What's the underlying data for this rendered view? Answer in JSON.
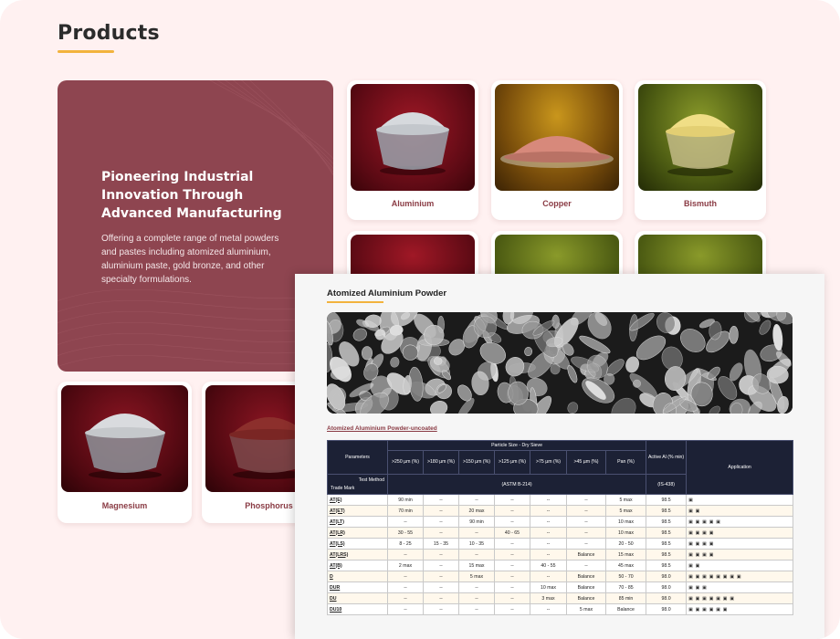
{
  "page": {
    "heading": "Products"
  },
  "hero": {
    "title": "Pioneering Industrial Innovation Through Advanced Manufacturing",
    "description": "Offering a complete range of metal powders and pastes including atomized aluminium, aluminium paste, gold bronze, and other specialty formulations."
  },
  "products": [
    {
      "name": "Aluminium",
      "color": "#bfc3c8",
      "bg": "#6e0f1a"
    },
    {
      "name": "Copper",
      "color": "#d88a78",
      "bg": "#8a5a10"
    },
    {
      "name": "Bismuth",
      "color": "#e9d57a",
      "bg": "#4b5a12"
    },
    {
      "name": "Magnesium",
      "color": "#bdbdbd",
      "bg": "#5a0c14"
    },
    {
      "name": "Phosphorus",
      "color": "#8c2f2c",
      "bg": "#5a0c14"
    }
  ],
  "panel": {
    "title": "Atomized Aluminium Powder",
    "subtitle": "Atomized Aluminium Powder-uncoated",
    "table": {
      "head_parameters": "Parameters",
      "head_particle": "Particle Size - Dry Sieve",
      "head_active": "Active Al (% min)",
      "head_application": "Application",
      "sizes": [
        ">250 µm (%)",
        ">180 µm (%)",
        ">150 µm (%)",
        ">125 µm (%)",
        ">75 µm (%)",
        ">45 µm (%)",
        "Pan (%)"
      ],
      "test_method": "Test Method",
      "trade_mark": "Trade Mark",
      "method_sieve": "(ASTM B-214)",
      "method_active": "(IS-438)",
      "rows": [
        {
          "tm": "AT(E)",
          "v": [
            "90 min",
            "--",
            "--",
            "--",
            "--",
            "--",
            "5 max"
          ],
          "al": "98.5",
          "app": "▣"
        },
        {
          "tm": "AT(ET)",
          "v": [
            "70 min",
            "--",
            "20 max",
            "--",
            "--",
            "--",
            "5 max"
          ],
          "al": "98.5",
          "app": "▣ ▣"
        },
        {
          "tm": "AT(LT)",
          "v": [
            "--",
            "--",
            "90 min",
            "--",
            "--",
            "--",
            "10 max"
          ],
          "al": "98.5",
          "app": "▣ ▣ ▣ ▣ ▣"
        },
        {
          "tm": "AT(LR)",
          "v": [
            "30 - 55",
            "--",
            "--",
            "40 - 65",
            "--",
            "--",
            "10 max"
          ],
          "al": "98.5",
          "app": "▣ ▣ ▣ ▣"
        },
        {
          "tm": "AT(LS)",
          "v": [
            "8 - 25",
            "15 - 35",
            "10 - 35",
            "--",
            "--",
            "--",
            "20 - 50"
          ],
          "al": "98.5",
          "app": "▣ ▣ ▣ ▣"
        },
        {
          "tm": "AT(LRS)",
          "v": [
            "--",
            "--",
            "--",
            "--",
            "--",
            "Balance",
            "15 max"
          ],
          "al": "98.5",
          "app": "▣ ▣ ▣ ▣"
        },
        {
          "tm": "AT(B)",
          "v": [
            "2 max",
            "--",
            "15 max",
            "--",
            "40 - 55",
            "--",
            "45 max"
          ],
          "al": "98.5",
          "app": "▣ ▣"
        },
        {
          "tm": "D",
          "v": [
            "--",
            "--",
            "5 max",
            "--",
            "--",
            "Balance",
            "50 - 70"
          ],
          "al": "98.0",
          "app": "▣ ▣ ▣ ▣ ▣ ▣ ▣ ▣"
        },
        {
          "tm": "DUR",
          "v": [
            "--",
            "--",
            "--",
            "--",
            "10 max",
            "Balance",
            "70 - 85"
          ],
          "al": "98.0",
          "app": "▣ ▣ ▣"
        },
        {
          "tm": "DU",
          "v": [
            "--",
            "--",
            "--",
            "--",
            "3 max",
            "Balance",
            "85 min"
          ],
          "al": "98.0",
          "app": "▣ ▣ ▣ ▣ ▣ ▣ ▣"
        },
        {
          "tm": "DU10",
          "v": [
            "--",
            "--",
            "--",
            "--",
            "--",
            "5 max",
            "Balance"
          ],
          "al": "98.0",
          "app": "▣ ▣ ▣ ▣ ▣ ▣"
        }
      ]
    }
  },
  "colors": {
    "hero_bg": "#8e4550",
    "accent": "#f2b33d",
    "table_head": "#1c2135",
    "label": "#8a3b44"
  }
}
